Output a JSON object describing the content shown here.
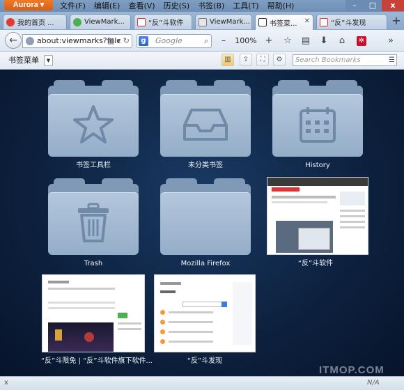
{
  "window": {
    "app_button": "Aurora ▾",
    "menu": [
      "文件(F)",
      "编辑(E)",
      "查看(V)",
      "历史(S)",
      "书签(B)",
      "工具(T)",
      "帮助(H)"
    ],
    "controls": {
      "minimize": "–",
      "maximize": "□",
      "close": "x"
    }
  },
  "tabs": [
    {
      "label": "我的首页 ...",
      "active": false
    },
    {
      "label": "ViewMark...",
      "active": false
    },
    {
      "label": "“反”斗软件",
      "active": false
    },
    {
      "label": "ViewMark...",
      "active": false
    },
    {
      "label": "书签菜...",
      "active": true
    },
    {
      "label": "“反”斗发现",
      "active": false
    }
  ],
  "nav": {
    "url": "about:viewmarks?folc",
    "search_placeholder": "Google",
    "zoom": "100%"
  },
  "bookmarks_toolbar": {
    "menu_label": "书签菜单",
    "search_placeholder": "Search Bookmarks"
  },
  "items": [
    {
      "label": "书签工具栏",
      "type": "folder",
      "icon": "star-icon"
    },
    {
      "label": "未分类书签",
      "type": "folder",
      "icon": "inbox-icon"
    },
    {
      "label": "History",
      "type": "folder",
      "icon": "calendar-icon"
    },
    {
      "label": "Trash",
      "type": "folder",
      "icon": "trash-icon"
    },
    {
      "label": "Mozilla Firefox",
      "type": "folder",
      "icon": "none"
    },
    {
      "label": "“反”斗软件",
      "type": "thumbnail"
    },
    {
      "label": "“反”斗限免 | “反”斗软件旗下软件...",
      "type": "thumbnail"
    },
    {
      "label": "“反”斗发现",
      "type": "thumbnail"
    }
  ],
  "status": {
    "close": "x",
    "na": "N/A"
  },
  "watermark": "ITMOP.COM"
}
